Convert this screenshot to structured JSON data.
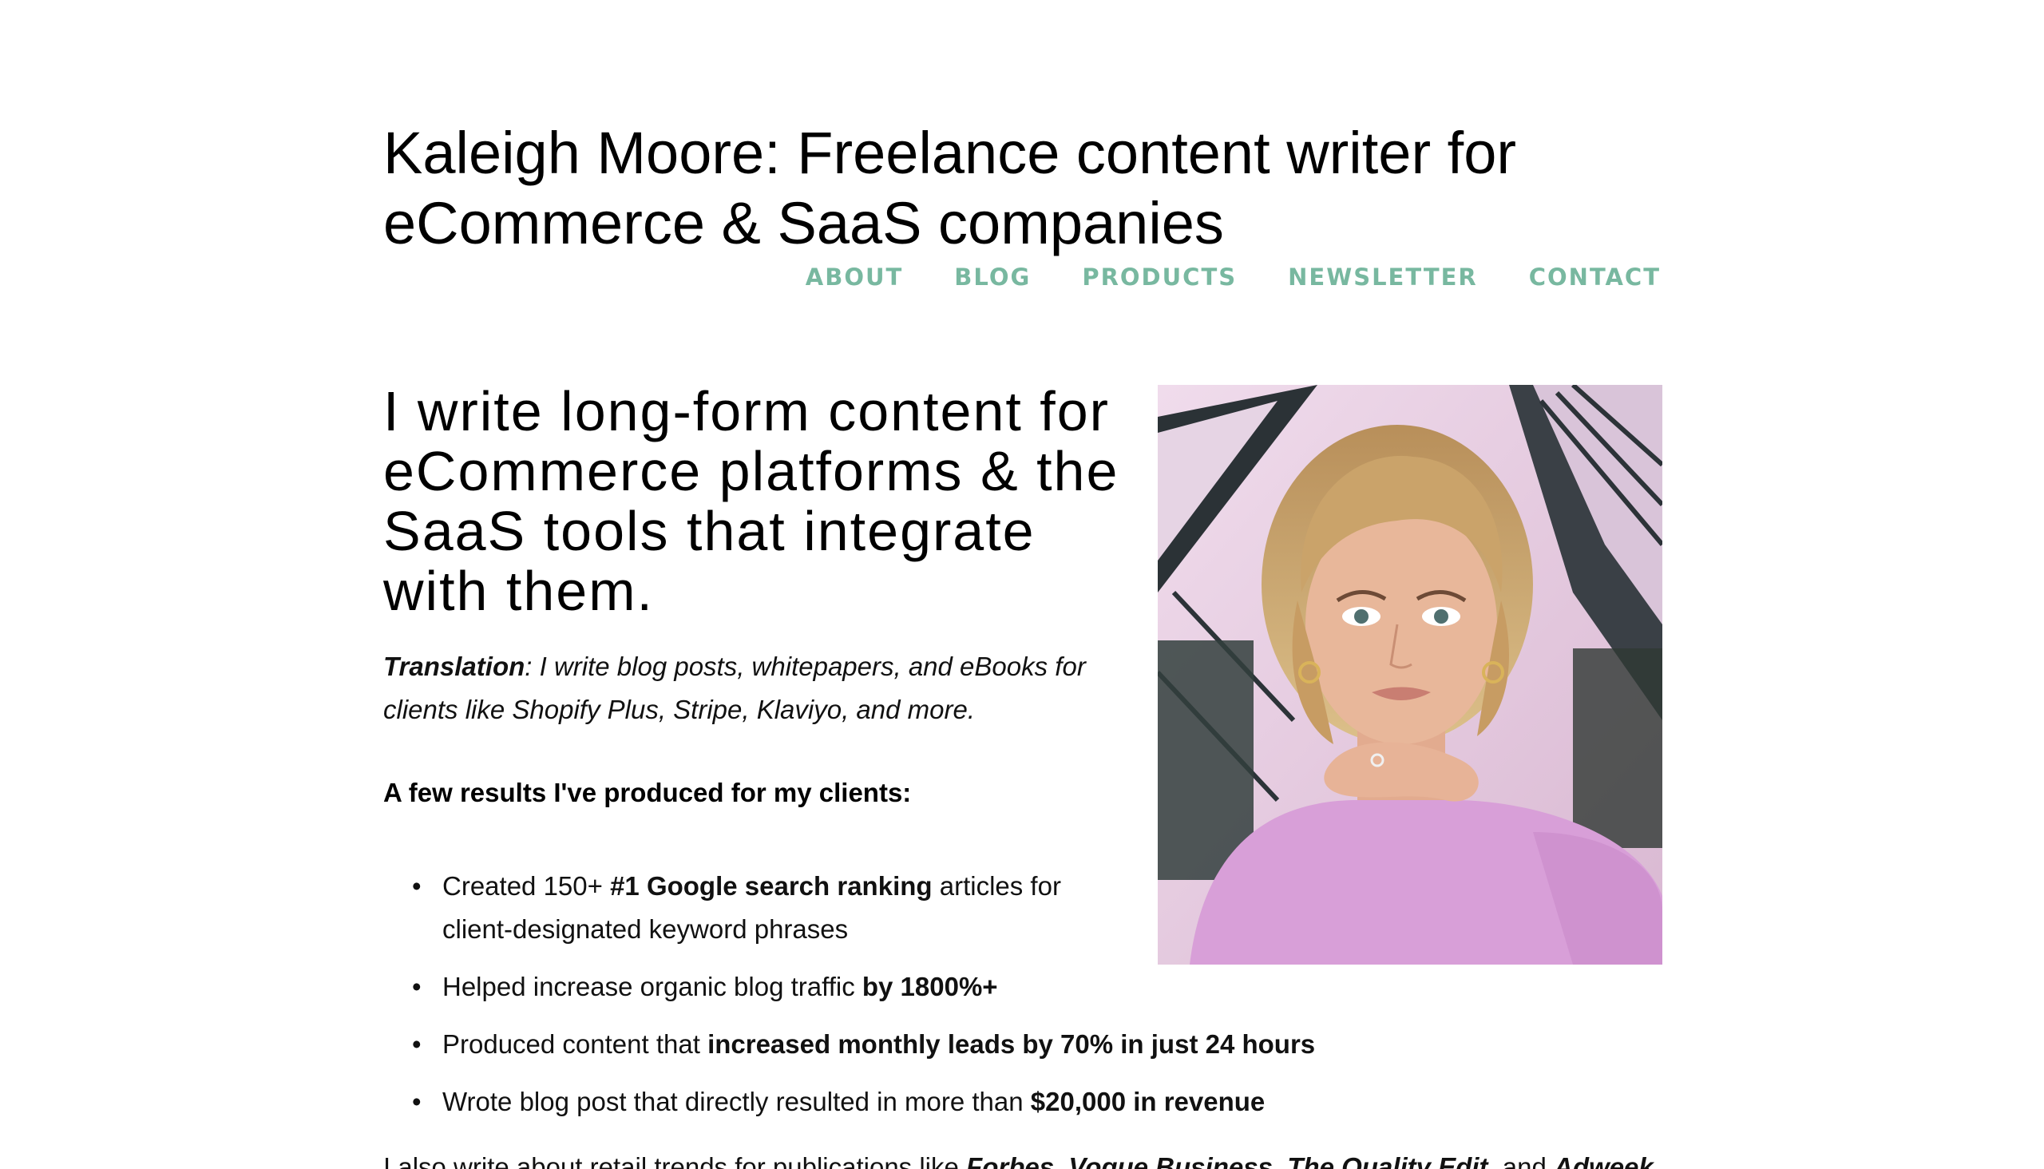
{
  "site": {
    "title": "Kaleigh Moore: Freelance content writer for eCommerce & SaaS companies"
  },
  "nav": {
    "items": [
      "ABOUT",
      "BLOG",
      "PRODUCTS",
      "NEWSLETTER",
      "CONTACT"
    ]
  },
  "hero": {
    "headline": "I write long-form content for eCommerce platforms & the SaaS tools that integrate with them.",
    "translation_label": "Translation",
    "translation_text": ": I write blog posts, whitepapers, and eBooks for clients like Shopify Plus, Stripe, Klaviyo, and more."
  },
  "results": {
    "heading": "A few results I've produced for my clients:",
    "items": [
      {
        "pre": "Created 150+ ",
        "bold": "#1 Google search ranking",
        "post": " articles for client-designated keyword phrases"
      },
      {
        "pre": "Helped increase organic blog traffic ",
        "bold": "by 1800%+",
        "post": ""
      },
      {
        "pre": "Produced content that ",
        "bold": "increased monthly leads by 70% in just 24 hours",
        "post": ""
      },
      {
        "pre": "Wrote blog post that directly resulted in more than ",
        "bold": "$20,000 in revenue",
        "post": ""
      }
    ]
  },
  "publications": {
    "pre": "I also write about retail trends for publications like ",
    "items": [
      "Forbes",
      "Vogue Business",
      "The Quality Edit",
      "Adweek"
    ],
    "sep1": ", ",
    "sep2": ", ",
    "sep3": ", and "
  },
  "photo": {
    "alt": "portrait-photo",
    "colors": {
      "sweater": "#d89fd8",
      "hair": "#caa36a",
      "skin": "#e8b79a",
      "background": "#e9cfe4"
    }
  },
  "colors": {
    "nav": "#78b8a0",
    "text": "#111111",
    "background": "#ffffff"
  }
}
